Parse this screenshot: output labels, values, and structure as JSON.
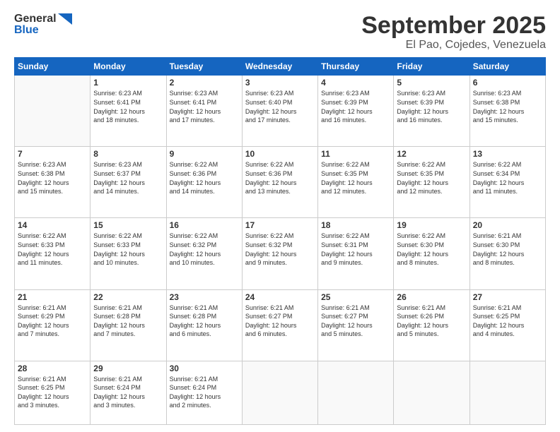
{
  "logo": {
    "line1": "General",
    "line2": "Blue"
  },
  "header": {
    "month": "September 2025",
    "location": "El Pao, Cojedes, Venezuela"
  },
  "days_of_week": [
    "Sunday",
    "Monday",
    "Tuesday",
    "Wednesday",
    "Thursday",
    "Friday",
    "Saturday"
  ],
  "weeks": [
    [
      {
        "num": "",
        "info": ""
      },
      {
        "num": "1",
        "info": "Sunrise: 6:23 AM\nSunset: 6:41 PM\nDaylight: 12 hours\nand 18 minutes."
      },
      {
        "num": "2",
        "info": "Sunrise: 6:23 AM\nSunset: 6:41 PM\nDaylight: 12 hours\nand 17 minutes."
      },
      {
        "num": "3",
        "info": "Sunrise: 6:23 AM\nSunset: 6:40 PM\nDaylight: 12 hours\nand 17 minutes."
      },
      {
        "num": "4",
        "info": "Sunrise: 6:23 AM\nSunset: 6:39 PM\nDaylight: 12 hours\nand 16 minutes."
      },
      {
        "num": "5",
        "info": "Sunrise: 6:23 AM\nSunset: 6:39 PM\nDaylight: 12 hours\nand 16 minutes."
      },
      {
        "num": "6",
        "info": "Sunrise: 6:23 AM\nSunset: 6:38 PM\nDaylight: 12 hours\nand 15 minutes."
      }
    ],
    [
      {
        "num": "7",
        "info": "Sunrise: 6:23 AM\nSunset: 6:38 PM\nDaylight: 12 hours\nand 15 minutes."
      },
      {
        "num": "8",
        "info": "Sunrise: 6:23 AM\nSunset: 6:37 PM\nDaylight: 12 hours\nand 14 minutes."
      },
      {
        "num": "9",
        "info": "Sunrise: 6:22 AM\nSunset: 6:36 PM\nDaylight: 12 hours\nand 14 minutes."
      },
      {
        "num": "10",
        "info": "Sunrise: 6:22 AM\nSunset: 6:36 PM\nDaylight: 12 hours\nand 13 minutes."
      },
      {
        "num": "11",
        "info": "Sunrise: 6:22 AM\nSunset: 6:35 PM\nDaylight: 12 hours\nand 12 minutes."
      },
      {
        "num": "12",
        "info": "Sunrise: 6:22 AM\nSunset: 6:35 PM\nDaylight: 12 hours\nand 12 minutes."
      },
      {
        "num": "13",
        "info": "Sunrise: 6:22 AM\nSunset: 6:34 PM\nDaylight: 12 hours\nand 11 minutes."
      }
    ],
    [
      {
        "num": "14",
        "info": "Sunrise: 6:22 AM\nSunset: 6:33 PM\nDaylight: 12 hours\nand 11 minutes."
      },
      {
        "num": "15",
        "info": "Sunrise: 6:22 AM\nSunset: 6:33 PM\nDaylight: 12 hours\nand 10 minutes."
      },
      {
        "num": "16",
        "info": "Sunrise: 6:22 AM\nSunset: 6:32 PM\nDaylight: 12 hours\nand 10 minutes."
      },
      {
        "num": "17",
        "info": "Sunrise: 6:22 AM\nSunset: 6:32 PM\nDaylight: 12 hours\nand 9 minutes."
      },
      {
        "num": "18",
        "info": "Sunrise: 6:22 AM\nSunset: 6:31 PM\nDaylight: 12 hours\nand 9 minutes."
      },
      {
        "num": "19",
        "info": "Sunrise: 6:22 AM\nSunset: 6:30 PM\nDaylight: 12 hours\nand 8 minutes."
      },
      {
        "num": "20",
        "info": "Sunrise: 6:21 AM\nSunset: 6:30 PM\nDaylight: 12 hours\nand 8 minutes."
      }
    ],
    [
      {
        "num": "21",
        "info": "Sunrise: 6:21 AM\nSunset: 6:29 PM\nDaylight: 12 hours\nand 7 minutes."
      },
      {
        "num": "22",
        "info": "Sunrise: 6:21 AM\nSunset: 6:28 PM\nDaylight: 12 hours\nand 7 minutes."
      },
      {
        "num": "23",
        "info": "Sunrise: 6:21 AM\nSunset: 6:28 PM\nDaylight: 12 hours\nand 6 minutes."
      },
      {
        "num": "24",
        "info": "Sunrise: 6:21 AM\nSunset: 6:27 PM\nDaylight: 12 hours\nand 6 minutes."
      },
      {
        "num": "25",
        "info": "Sunrise: 6:21 AM\nSunset: 6:27 PM\nDaylight: 12 hours\nand 5 minutes."
      },
      {
        "num": "26",
        "info": "Sunrise: 6:21 AM\nSunset: 6:26 PM\nDaylight: 12 hours\nand 5 minutes."
      },
      {
        "num": "27",
        "info": "Sunrise: 6:21 AM\nSunset: 6:25 PM\nDaylight: 12 hours\nand 4 minutes."
      }
    ],
    [
      {
        "num": "28",
        "info": "Sunrise: 6:21 AM\nSunset: 6:25 PM\nDaylight: 12 hours\nand 3 minutes."
      },
      {
        "num": "29",
        "info": "Sunrise: 6:21 AM\nSunset: 6:24 PM\nDaylight: 12 hours\nand 3 minutes."
      },
      {
        "num": "30",
        "info": "Sunrise: 6:21 AM\nSunset: 6:24 PM\nDaylight: 12 hours\nand 2 minutes."
      },
      {
        "num": "",
        "info": ""
      },
      {
        "num": "",
        "info": ""
      },
      {
        "num": "",
        "info": ""
      },
      {
        "num": "",
        "info": ""
      }
    ]
  ]
}
